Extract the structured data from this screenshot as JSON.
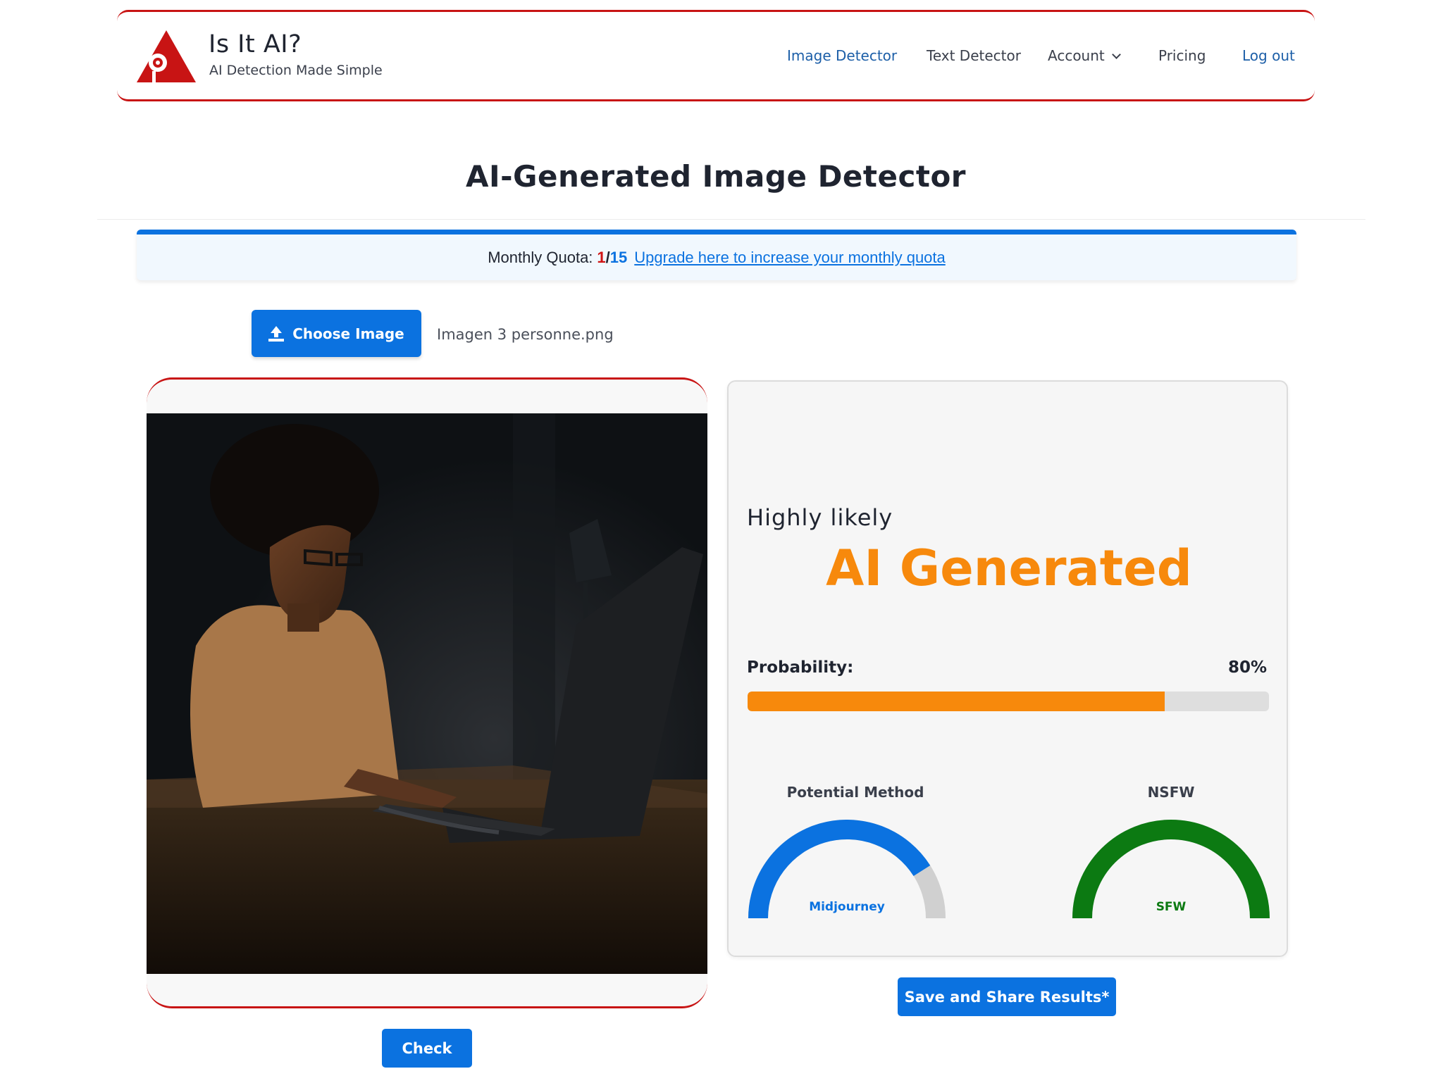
{
  "brand": {
    "title": "Is It AI?",
    "tagline": "AI Detection Made Simple",
    "accent_color": "#c81414"
  },
  "nav": {
    "items": [
      {
        "label": "Image Detector",
        "active": true
      },
      {
        "label": "Text Detector"
      },
      {
        "label": "Account",
        "icon": "chevron-down-icon"
      },
      {
        "label": "Pricing"
      },
      {
        "label": "Log out"
      }
    ]
  },
  "page": {
    "title": "AI-Generated Image Detector"
  },
  "quota": {
    "label": "Monthly Quota:",
    "used": "1",
    "separator": "/",
    "total": "15",
    "upgrade_link": "Upgrade here to increase your monthly quota"
  },
  "upload": {
    "button_label": "Choose Image",
    "button_icon": "upload-icon",
    "filename": "Imagen 3 personne.png"
  },
  "preview": {
    "image": "photo of a woman wearing glasses typing on a laptop at a desk in a dark room"
  },
  "actions": {
    "check_label": "Check",
    "save_label": "Save and Share Results*"
  },
  "result": {
    "likelihood": "Highly likely",
    "verdict": "AI Generated",
    "verdict_color": "#f7890c",
    "probability_label": "Probability:",
    "probability_text": "80%",
    "probability": 0.8,
    "method": {
      "title": "Potential Method",
      "value": "Midjourney",
      "fraction": 0.82,
      "color": "#0b72e0"
    },
    "nsfw": {
      "title": "NSFW",
      "value": "SFW",
      "fraction": 1.0,
      "color": "#0c7a12"
    }
  }
}
